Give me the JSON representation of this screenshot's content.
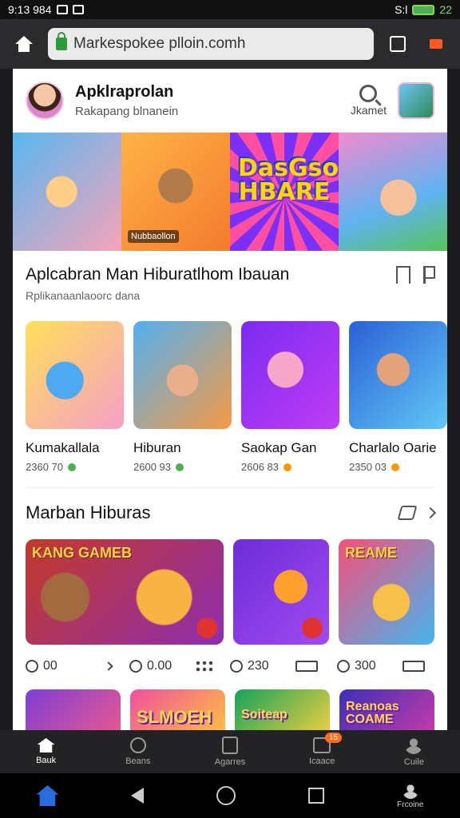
{
  "status": {
    "time": "9:13 984",
    "right": "S:l",
    "battery": "22"
  },
  "browser": {
    "url": "Markespokee plloin.comh"
  },
  "app_header": {
    "title": "Apklraprolan",
    "subtitle": "Rakapang blnanein",
    "search_label": "Jkamet"
  },
  "banner": {
    "logo_text": "DasGso HBARE",
    "caption": "Nubbaollon"
  },
  "section1": {
    "title": "Aplcabran Man Hiburatlhom Ibauan",
    "subtitle": "Rplikanaanlaoorc dana",
    "cards": [
      {
        "name": "Kumakallala",
        "meta": "2360 70",
        "dot_color": "#4caf50"
      },
      {
        "name": "Hiburan",
        "meta": "2600 93",
        "dot_color": "#4caf50"
      },
      {
        "name": "Saokap Gan",
        "meta": "2606 83",
        "dot_color": "#ff9800"
      },
      {
        "name": "Charlalo Oarie",
        "meta": "2350 03",
        "dot_color": "#ff9800"
      }
    ]
  },
  "section2": {
    "title": "Marban Hiburas",
    "big_cards": [
      {
        "label": "KANG GAMEB"
      },
      {
        "label": ""
      },
      {
        "label": "REAME"
      }
    ],
    "stats": [
      "00",
      "0.00",
      "230",
      "300"
    ]
  },
  "bottom_row": [
    {
      "label": ""
    },
    {
      "label": "SLMOEH"
    },
    {
      "label": "Soiteap"
    },
    {
      "label": "Reanoas COAME"
    }
  ],
  "app_nav": [
    "Bauk",
    "Beans",
    "Agarres",
    "Icaace",
    "Cuile"
  ],
  "app_nav_badge": "15",
  "sys_nav": {
    "home_label": "",
    "profile_label": "Frcoine"
  }
}
